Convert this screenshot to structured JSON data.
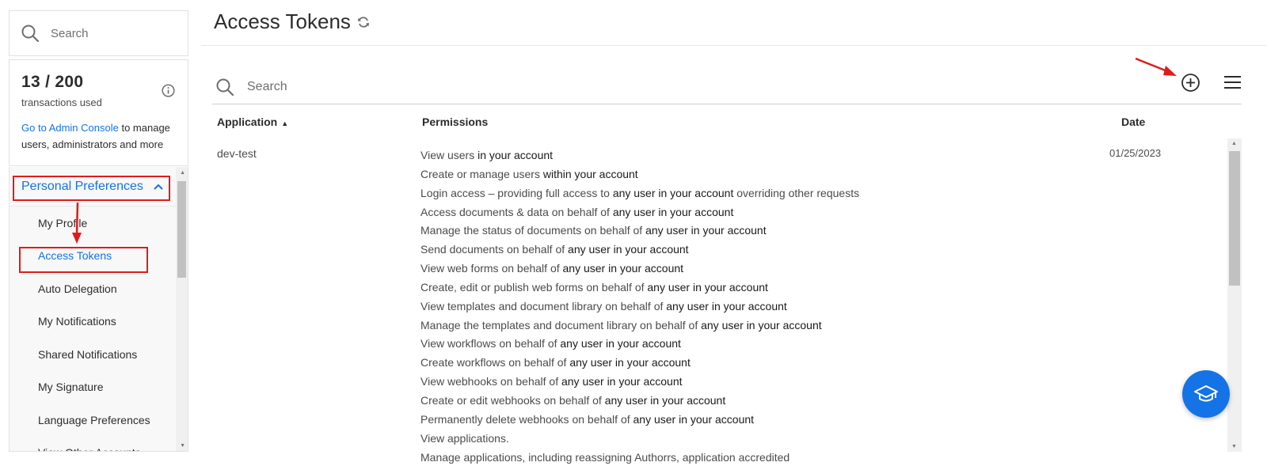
{
  "sidebar": {
    "search_placeholder": "Search",
    "transactions": {
      "count": "13 / 200",
      "label": "transactions used",
      "admin_link": "Go to Admin Console",
      "admin_text": " to manage users, administrators and more"
    },
    "section_title": "Personal Preferences",
    "items": [
      {
        "label": "My Profile"
      },
      {
        "label": "Access Tokens"
      },
      {
        "label": "Auto Delegation"
      },
      {
        "label": "My Notifications"
      },
      {
        "label": "Shared Notifications"
      },
      {
        "label": "My Signature"
      },
      {
        "label": "Language Preferences"
      },
      {
        "label": "View Other Accounts"
      }
    ]
  },
  "main": {
    "title": "Access Tokens",
    "search_placeholder": "Search",
    "columns": {
      "application": "Application",
      "permissions": "Permissions",
      "date": "Date"
    },
    "rows": [
      {
        "application": "dev-test",
        "date": "01/25/2023",
        "permissions": [
          [
            "View users",
            " in your account"
          ],
          [
            "Create or manage users",
            " within your account"
          ],
          [
            "Login access – providing full access to ",
            "any user in your account",
            " overriding other requests"
          ],
          [
            "Access documents & data on behalf of ",
            "any user in your account"
          ],
          [
            "Manage the status of documents on behalf of ",
            "any user in your account"
          ],
          [
            "Send documents on behalf of ",
            "any user in your account"
          ],
          [
            "View web forms on behalf of ",
            "any user in your account"
          ],
          [
            "Create, edit or publish web forms on behalf of ",
            "any user in your account"
          ],
          [
            "View templates and document library on behalf of ",
            "any user in your account"
          ],
          [
            "Manage the templates and document library on behalf of ",
            "any user in your account"
          ],
          [
            "View workflows on behalf of ",
            "any user in your account"
          ],
          [
            "Create workflows on behalf of ",
            "any user in your account"
          ],
          [
            "View webhooks on behalf of ",
            "any user in your account"
          ],
          [
            "Create or edit webhooks on behalf of ",
            "any user in your account"
          ],
          [
            "Permanently delete webhooks on behalf of ",
            "any user in your account"
          ],
          [
            "View applications."
          ],
          [
            "Manage applications, including reassigning Authorrs, application accredited"
          ]
        ]
      }
    ]
  },
  "colors": {
    "accent": "#1473e6",
    "annotation": "#e01b1b"
  },
  "icons": [
    "search-icon",
    "info-icon",
    "chevron-up-icon",
    "refresh-icon",
    "add-circle-icon",
    "hamburger-menu-icon",
    "graduation-cap-icon"
  ]
}
